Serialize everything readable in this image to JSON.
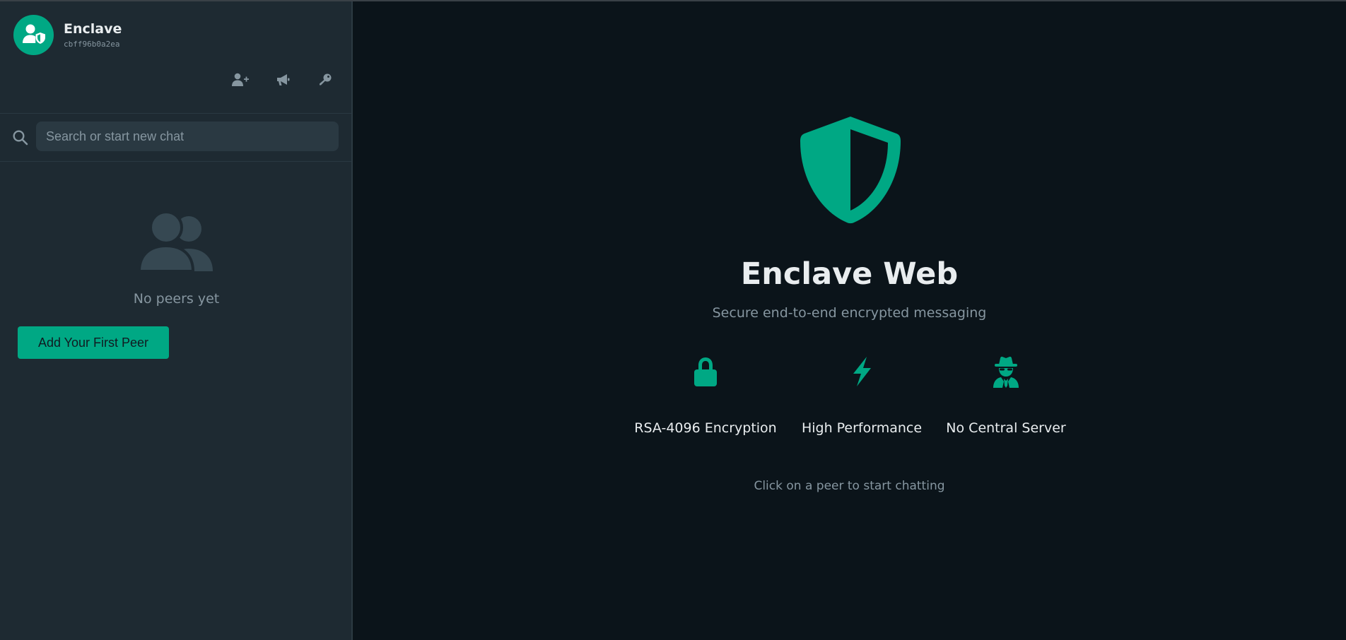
{
  "colors": {
    "accent": "#00a884",
    "sidebar_bg": "#1e2a32",
    "main_bg": "#0b141a",
    "muted_text": "#8696a0",
    "primary_text": "#e9edef"
  },
  "profile": {
    "name": "Enclave",
    "id": "cbff96b0a2ea",
    "avatar_icon": "user-shield-icon"
  },
  "toolbar": {
    "items": [
      {
        "icon": "user-plus-icon"
      },
      {
        "icon": "megaphone-icon"
      },
      {
        "icon": "key-icon"
      }
    ]
  },
  "search": {
    "placeholder": "Search or start new chat",
    "value": ""
  },
  "peers": {
    "empty_icon": "users-icon",
    "empty_text": "No peers yet",
    "add_button_label": "Add Your First Peer"
  },
  "welcome": {
    "logo_icon": "shield-icon",
    "title": "Enclave Web",
    "subtitle": "Secure end-to-end encrypted messaging",
    "features": [
      {
        "icon": "lock-icon",
        "label": "RSA-4096 Encryption"
      },
      {
        "icon": "bolt-icon",
        "label": "High Performance"
      },
      {
        "icon": "user-secret-icon",
        "label": "No Central Server"
      }
    ],
    "hint": "Click on a peer to start chatting"
  }
}
